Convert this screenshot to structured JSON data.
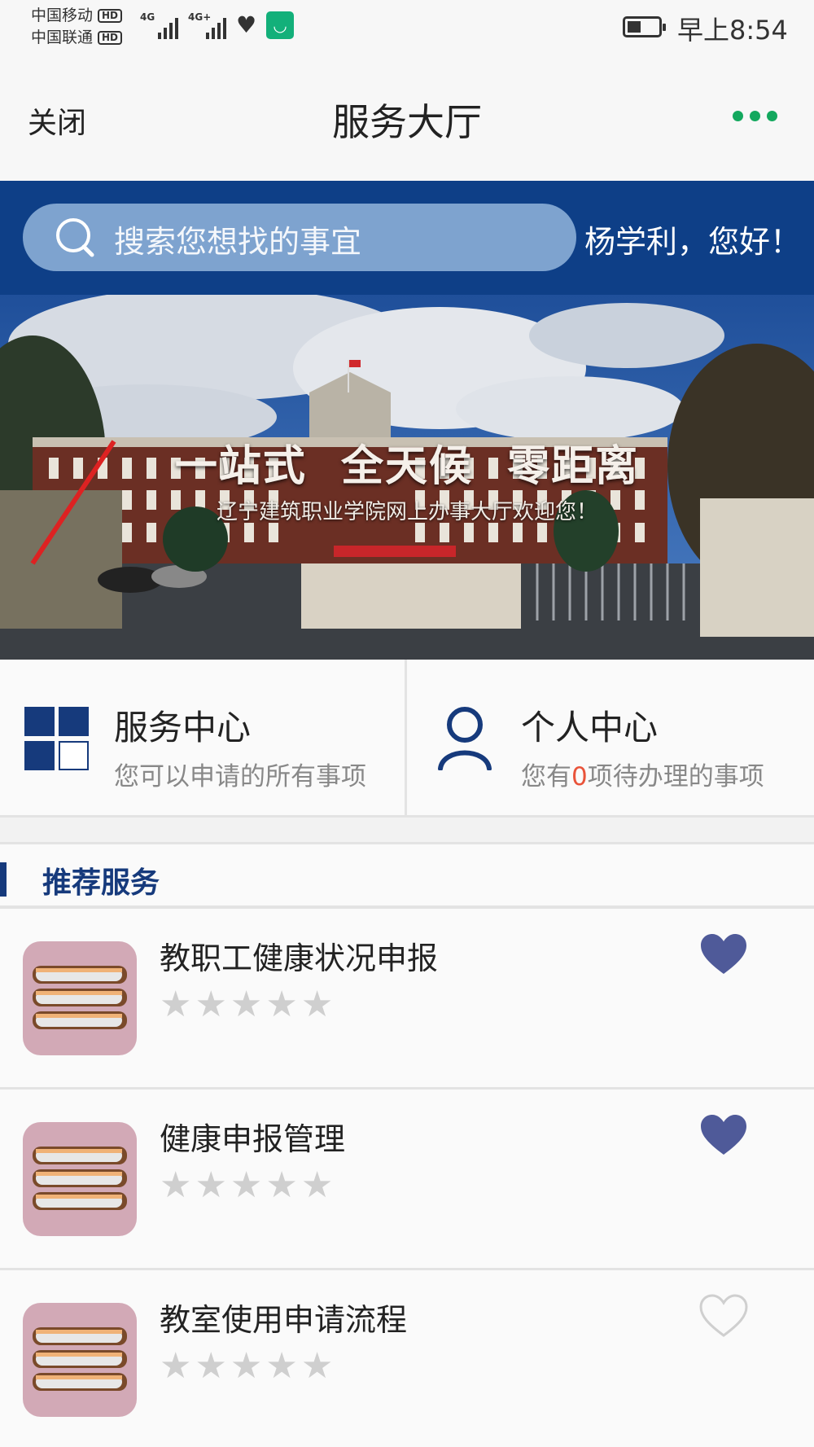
{
  "status_bar": {
    "carrier1": "中国移动",
    "carrier2": "中国联通",
    "hd": "HD",
    "net1": "4G",
    "net2": "4G+",
    "time": "早上8:54"
  },
  "nav": {
    "close_label": "关闭",
    "title": "服务大厅",
    "more_icon": "more-dots-icon"
  },
  "search": {
    "placeholder": "搜索您想找的事宜",
    "greeting": "杨学利，您好！"
  },
  "banner": {
    "title": "一站式 全天候 零距离",
    "subtitle": "辽宁建筑职业学院网上办事大厅欢迎您！"
  },
  "quick_links": [
    {
      "title": "服务中心",
      "desc": "您可以申请的所有事项",
      "icon": "grid-icon"
    },
    {
      "title": "个人中心",
      "desc_prefix": "您有",
      "pending_count": "0",
      "desc_suffix": "项待办理的事项",
      "icon": "person-icon"
    }
  ],
  "section": {
    "title": "推荐服务"
  },
  "services": [
    {
      "name": "教职工健康状况申报",
      "rating": 0,
      "favorited": true
    },
    {
      "name": "健康申报管理",
      "rating": 0,
      "favorited": true
    },
    {
      "name": "教室使用申请流程",
      "rating": 0,
      "favorited": false
    }
  ],
  "colors": {
    "brand_blue": "#0e3f87",
    "accent_green": "#13a85e",
    "heart_filled": "#4f5a99",
    "pending_red": "#e9533a"
  }
}
